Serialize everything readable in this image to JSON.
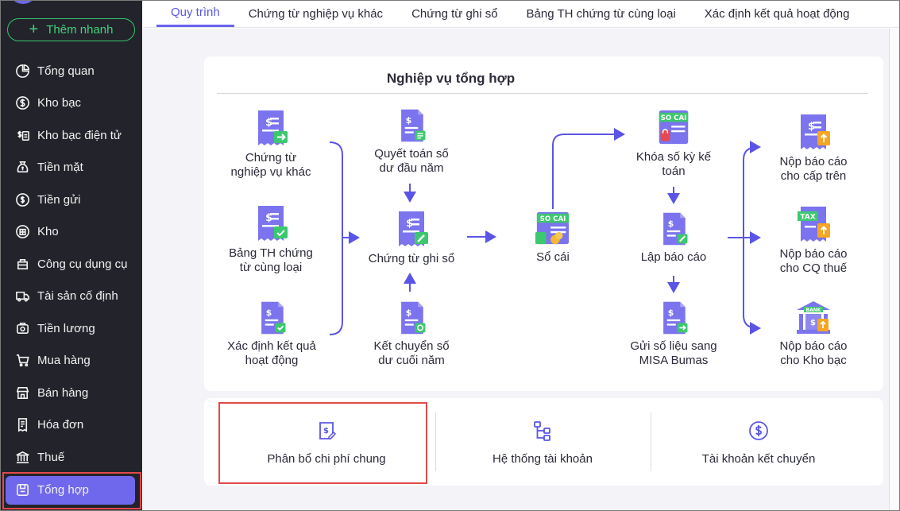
{
  "sidebar": {
    "quick_add": "Thêm nhanh",
    "items": [
      {
        "label": "Tổng quan",
        "icon": "pie-chart-icon"
      },
      {
        "label": "Kho bạc",
        "icon": "dollar-circle-icon"
      },
      {
        "label": "Kho bạc điện tử",
        "icon": "dollar-card-icon"
      },
      {
        "label": "Tiền mặt",
        "icon": "cash-bag-icon"
      },
      {
        "label": "Tiền gửi",
        "icon": "deposit-icon"
      },
      {
        "label": "Kho",
        "icon": "warehouse-icon"
      },
      {
        "label": "Công cụ dụng cụ",
        "icon": "tools-icon"
      },
      {
        "label": "Tài sản cố định",
        "icon": "truck-icon"
      },
      {
        "label": "Tiền lương",
        "icon": "salary-icon"
      },
      {
        "label": "Mua hàng",
        "icon": "cart-icon"
      },
      {
        "label": "Bán hàng",
        "icon": "shop-icon"
      },
      {
        "label": "Hóa đơn",
        "icon": "invoice-icon"
      },
      {
        "label": "Thuế",
        "icon": "tax-building-icon"
      },
      {
        "label": "Tổng hợp",
        "icon": "summary-icon",
        "active": true
      }
    ]
  },
  "tabs": [
    {
      "label": "Quy trình",
      "active": true
    },
    {
      "label": "Chứng từ nghiệp vụ khác"
    },
    {
      "label": "Chứng từ ghi sổ"
    },
    {
      "label": "Bảng TH chứng từ cùng loại"
    },
    {
      "label": "Xác định kết quả hoạt động"
    }
  ],
  "process": {
    "title": "Nghiệp vụ tổng hợp",
    "nodes": {
      "ct_nvk": "Chứng từ\nnghiệp vụ khác",
      "bang_th": "Bảng TH chứng\ntừ cùng loại",
      "xd_kq": "Xác định kết quả\nhoạt động",
      "qt_so_du": "Quyết toán số\ndư đầu năm",
      "ct_ghi_so": "Chứng từ ghi sổ",
      "kc_so_du": "Kết chuyển số\ndư cuối năm",
      "so_cai": "Sổ cái",
      "khoa_so": "Khóa số kỳ kế\ntoán",
      "lap_bc": "Lập báo cáo",
      "gui_sl": "Gửi số liệu sang\nMISA Bumas",
      "nop_ct": "Nộp báo cáo\ncho cấp trên",
      "nop_cq": "Nộp báo cáo\ncho CQ thuế",
      "nop_kb": "Nộp báo cáo\ncho Kho bạc"
    },
    "badges": {
      "so_cai": "SO CAI",
      "tax": "TAX",
      "bank": "BANK"
    }
  },
  "tools": [
    {
      "label": "Phân bổ chi phí chung",
      "icon": "dollar-edit-icon"
    },
    {
      "label": "Hệ thống tài khoản",
      "icon": "hierarchy-icon"
    },
    {
      "label": "Tài khoản kết chuyển",
      "icon": "dollar-circle-icon"
    }
  ],
  "colors": {
    "accent": "#6a64ec",
    "sidebar_bg": "#23232b",
    "quick_add": "#35c46d",
    "highlight": "#e04a4a",
    "icon_purple": "#7b74ee",
    "badge_green": "#3cc86e"
  }
}
